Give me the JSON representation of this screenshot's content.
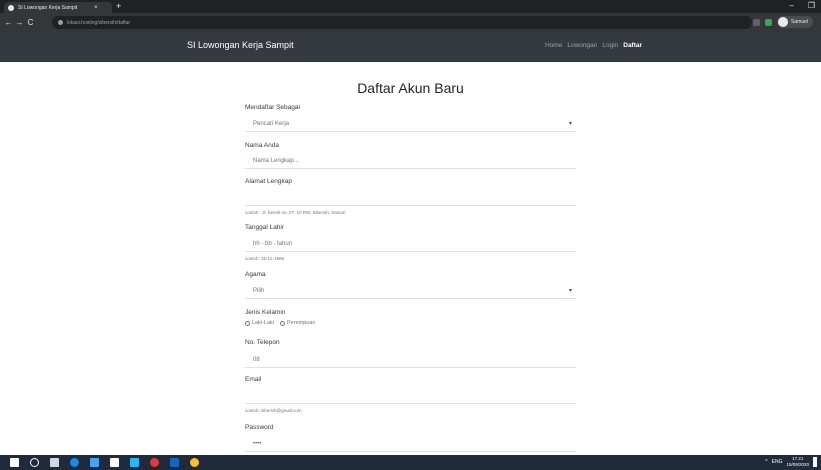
{
  "browser": {
    "tab_title": "SI Lowongan Kerja Sampit",
    "tab_close": "×",
    "new_tab": "+",
    "url": "lokasi.hosting/sibersih/daftar",
    "profile_name": "Samuel",
    "win_min": "–",
    "win_max": "❐",
    "win_close": "✕",
    "back": "←",
    "forward": "→",
    "reload": "C"
  },
  "navbar": {
    "brand": "SI Lowongan Kerja Sampit",
    "links": [
      {
        "label": "Home",
        "active": false
      },
      {
        "label": "Lowongan",
        "active": false
      },
      {
        "label": "Login",
        "active": false
      },
      {
        "label": "Daftar",
        "active": true
      }
    ]
  },
  "form": {
    "title": "Daftar Akun Baru",
    "fields": {
      "role": {
        "label": "Mendaftar Sebagai",
        "value": "Pencari Kerja"
      },
      "name": {
        "label": "Nama Anda",
        "placeholder": "Nama Lengkap..."
      },
      "address": {
        "label": "Alamat Lengkap",
        "help": "contoh : Jl. bersih no. 07, 10 RW, Sibersih, Samuri"
      },
      "birthdate": {
        "label": "Tanggal Lahir",
        "placeholder": "hh - bb - tahun",
        "help": "contoh: 15-12-1998"
      },
      "religion": {
        "label": "Agama",
        "value": "Pilih"
      },
      "gender": {
        "label": "Jenis Kelamin",
        "options": [
          "Laki-Laki",
          "Perempuan"
        ]
      },
      "phone": {
        "label": "No. Telepon",
        "value": "08"
      },
      "email": {
        "label": "Email",
        "help": "contoh: sibersih@gmail.com"
      },
      "password": {
        "label": "Password",
        "value": "••••"
      }
    }
  },
  "taskbar": {
    "tray_lang": "ENG",
    "time": "17.21",
    "date": "15/09/2020"
  },
  "colors": {
    "navbar_bg": "#343a40",
    "chrome_dark": "#202124",
    "taskbar_bg": "#1f2a3a"
  }
}
